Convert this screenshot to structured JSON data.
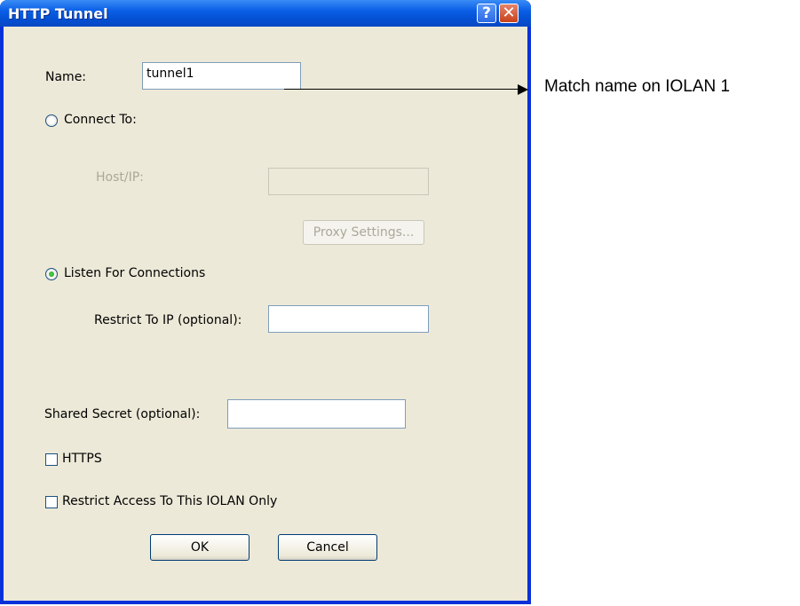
{
  "window": {
    "title": "HTTP Tunnel",
    "help_label": "?",
    "close_label": "✕"
  },
  "form": {
    "name_label": "Name:",
    "name_value": "tunnel1",
    "connect_to_label": "Connect To:",
    "connect_to_selected": false,
    "host_ip_label": "Host/IP:",
    "host_ip_value": "",
    "proxy_settings_label": "Proxy Settings...",
    "listen_label": "Listen For Connections",
    "listen_selected": true,
    "restrict_ip_label": "Restrict To IP (optional):",
    "restrict_ip_value": "",
    "shared_secret_label": "Shared Secret (optional):",
    "shared_secret_value": "",
    "https_label": "HTTPS",
    "https_checked": false,
    "restrict_access_label": "Restrict Access To This IOLAN Only",
    "restrict_access_checked": false
  },
  "buttons": {
    "ok_label": "OK",
    "cancel_label": "Cancel"
  },
  "annotation": {
    "text": "Match name on IOLAN 1"
  },
  "colors": {
    "titlebar": "#0a5fe6",
    "dialog_bg": "#ece9d8",
    "window_border": "#0831d9",
    "radio_selected": "#21a121",
    "disabled_text": "#aca899"
  }
}
